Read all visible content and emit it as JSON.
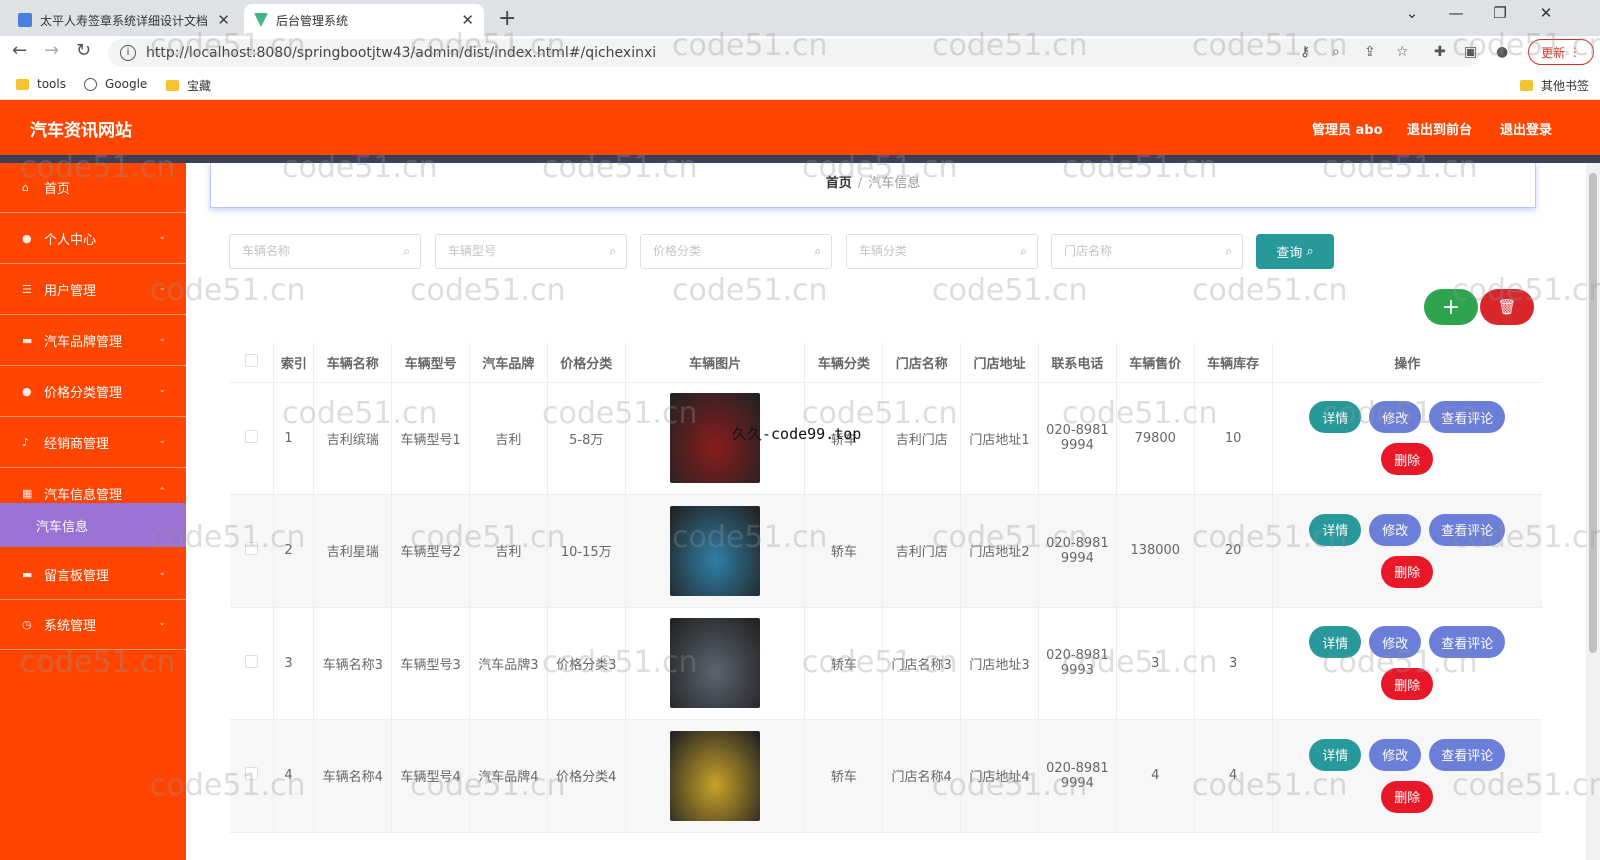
{
  "browser": {
    "tabs": [
      {
        "title": "太平人寿签章系统详细设计文档",
        "active": false
      },
      {
        "title": "后台管理系统",
        "active": true
      }
    ],
    "url": "http://localhost:8080/springbootjtw43/admin/dist/index.html#/qichexinxi",
    "update_label": "更新",
    "bookmarks": [
      "tools",
      "Google",
      "宝藏"
    ],
    "other_bookmarks": "其他书签"
  },
  "header": {
    "title": "汽车资讯网站",
    "user": "管理员 abo",
    "back_front": "退出到前台",
    "logout": "退出登录"
  },
  "sidebar": {
    "items": [
      {
        "label": "首页",
        "icon": "home-icon"
      },
      {
        "label": "个人中心",
        "icon": "user-icon"
      },
      {
        "label": "用户管理",
        "icon": "list-icon"
      },
      {
        "label": "汽车品牌管理",
        "icon": "folder-icon"
      },
      {
        "label": "价格分类管理",
        "icon": "user-icon"
      },
      {
        "label": "经销商管理",
        "icon": "mic-icon"
      },
      {
        "label": "汽车信息管理",
        "icon": "grid-icon"
      },
      {
        "label": "留言板管理",
        "icon": "folder-icon"
      },
      {
        "label": "系统管理",
        "icon": "clock-icon"
      }
    ],
    "sub_active": "汽车信息"
  },
  "breadcrumb": {
    "home": "首页",
    "sep": "/",
    "current": "汽车信息"
  },
  "search": {
    "placeholders": [
      "车辆名称",
      "车辆型号",
      "价格分类",
      "车辆分类",
      "门店名称"
    ],
    "query_label": "查询"
  },
  "table": {
    "headers": [
      "索引",
      "车辆名称",
      "车辆型号",
      "汽车品牌",
      "价格分类",
      "车辆图片",
      "车辆分类",
      "门店名称",
      "门店地址",
      "联系电话",
      "车辆售价",
      "车辆库存",
      "操作"
    ],
    "rows": [
      {
        "index": "1",
        "name": "吉利缤瑞",
        "model": "车辆型号1",
        "brand": "吉利",
        "price_cat": "5-8万",
        "category": "轿车",
        "store": "吉利门店",
        "address": "门店地址1",
        "phone1": "020-8981",
        "phone2": "9994",
        "price": "79800",
        "stock": "10",
        "img_color": "#8a1c1c"
      },
      {
        "index": "2",
        "name": "吉利星瑞",
        "model": "车辆型号2",
        "brand": "吉利",
        "price_cat": "10-15万",
        "category": "轿车",
        "store": "吉利门店",
        "address": "门店地址2",
        "phone1": "020-8981",
        "phone2": "9994",
        "price": "138000",
        "stock": "20",
        "img_color": "#2f7fa8"
      },
      {
        "index": "3",
        "name": "车辆名称3",
        "model": "车辆型号3",
        "brand": "汽车品牌3",
        "price_cat": "价格分类3",
        "category": "轿车",
        "store": "门店名称3",
        "address": "门店地址3",
        "phone1": "020-8981",
        "phone2": "9993",
        "price": "3",
        "stock": "3",
        "img_color": "#5a6470"
      },
      {
        "index": "4",
        "name": "车辆名称4",
        "model": "车辆型号4",
        "brand": "汽车品牌4",
        "price_cat": "价格分类4",
        "category": "轿车",
        "store": "门店名称4",
        "address": "门店地址4",
        "phone1": "020-8981",
        "phone2": "9994",
        "price": "4",
        "stock": "4",
        "img_color": "#c9a227"
      }
    ],
    "ops": {
      "detail": "详情",
      "edit": "修改",
      "comment": "查看评论",
      "delete": "删除"
    }
  },
  "overlay_text": "久久-code99.top",
  "watermark": "code51.cn",
  "colors": {
    "primary": "#ff4500",
    "sidebar_active": "#9b72d4",
    "teal": "#27999a",
    "indigo": "#6c7fd8",
    "red": "#e81828",
    "green": "#2ea44f"
  }
}
